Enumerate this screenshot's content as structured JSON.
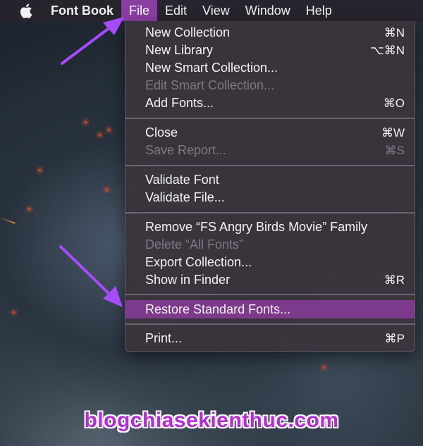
{
  "menubar": {
    "app_name": "Font Book",
    "items": [
      "File",
      "Edit",
      "View",
      "Window",
      "Help"
    ]
  },
  "file_menu": {
    "items": [
      {
        "label": "New Collection",
        "shortcut": "⌘N",
        "enabled": true
      },
      {
        "label": "New Library",
        "shortcut": "⌥⌘N",
        "enabled": true
      },
      {
        "label": "New Smart Collection...",
        "shortcut": "",
        "enabled": true
      },
      {
        "label": "Edit Smart Collection...",
        "shortcut": "",
        "enabled": false
      },
      {
        "label": "Add Fonts...",
        "shortcut": "⌘O",
        "enabled": true
      },
      {
        "label": "Close",
        "shortcut": "⌘W",
        "enabled": true
      },
      {
        "label": "Save Report...",
        "shortcut": "⌘S",
        "enabled": false
      },
      {
        "label": "Validate Font",
        "shortcut": "",
        "enabled": true
      },
      {
        "label": "Validate File...",
        "shortcut": "",
        "enabled": true
      },
      {
        "label": "Remove “FS Angry Birds Movie” Family",
        "shortcut": "",
        "enabled": true
      },
      {
        "label": "Delete “All Fonts”",
        "shortcut": "",
        "enabled": false
      },
      {
        "label": "Export Collection...",
        "shortcut": "",
        "enabled": true
      },
      {
        "label": "Show in Finder",
        "shortcut": "⌘R",
        "enabled": true
      },
      {
        "label": "Restore Standard Fonts...",
        "shortcut": "",
        "enabled": true,
        "highlighted": true
      },
      {
        "label": "Print...",
        "shortcut": "⌘P",
        "enabled": true
      }
    ]
  },
  "watermark": "blogchiasekienthuc.com",
  "colors": {
    "highlight": "#7d3a8c",
    "active_menu": "#8a3fa0",
    "arrow": "#a64bff",
    "watermark": "#b72ad9"
  },
  "icons": [
    "apple-logo-icon",
    "arrow-icon"
  ]
}
